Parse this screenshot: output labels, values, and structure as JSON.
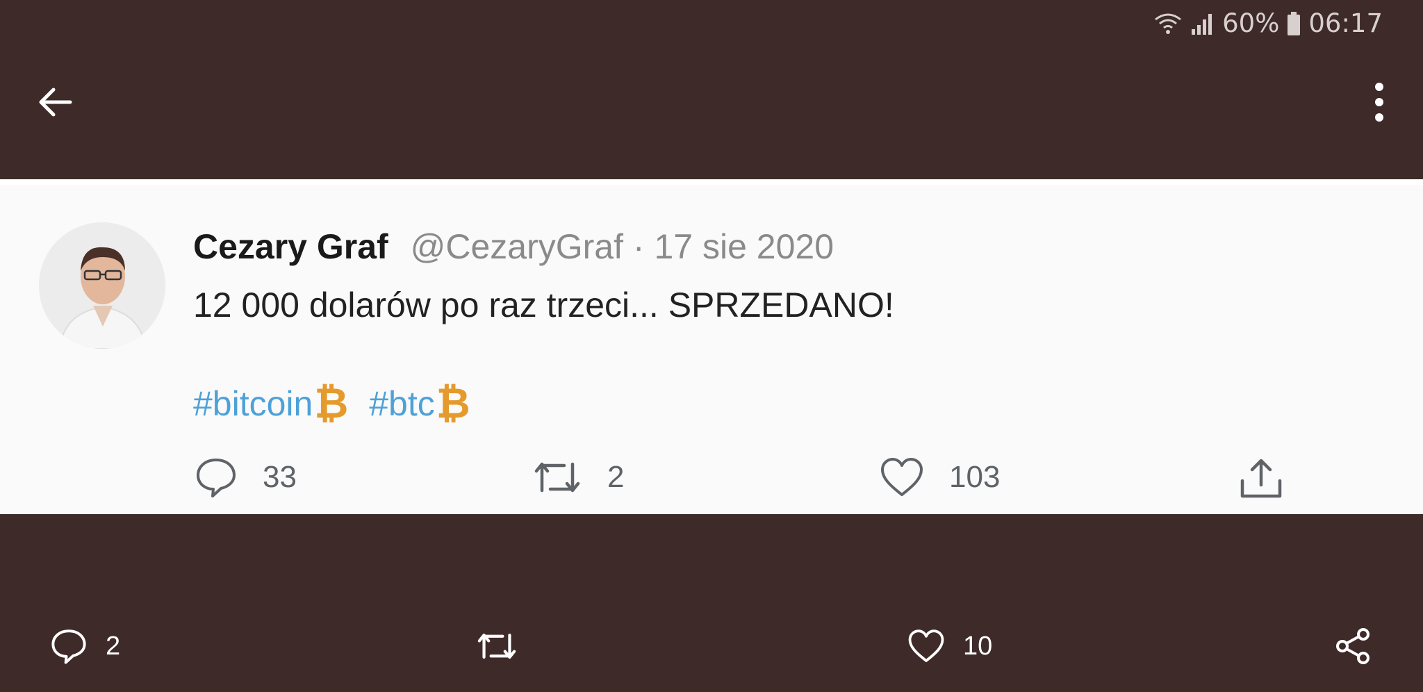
{
  "status_bar": {
    "battery": "60%",
    "time": "06:17"
  },
  "top_bar": {
    "back_icon": "arrow-left-icon",
    "more_icon": "more-vertical-icon"
  },
  "tweet": {
    "author_name": "Cezary Graf",
    "handle": "@CezaryGraf",
    "separator": "·",
    "date": "17 sie 2020",
    "text": "12 000 dolarów po raz trzeci... SPRZEDANO!",
    "hashtags": [
      "#bitcoin",
      "#btc"
    ],
    "hashtag_symbol": "₿",
    "replies": "33",
    "retweets": "2",
    "likes": "103"
  },
  "bottom_bar": {
    "comments": "2",
    "likes": "10"
  },
  "colors": {
    "background": "#3e2a29",
    "hashtag": "#4ea1d8",
    "bitcoin": "#e59a2c"
  }
}
